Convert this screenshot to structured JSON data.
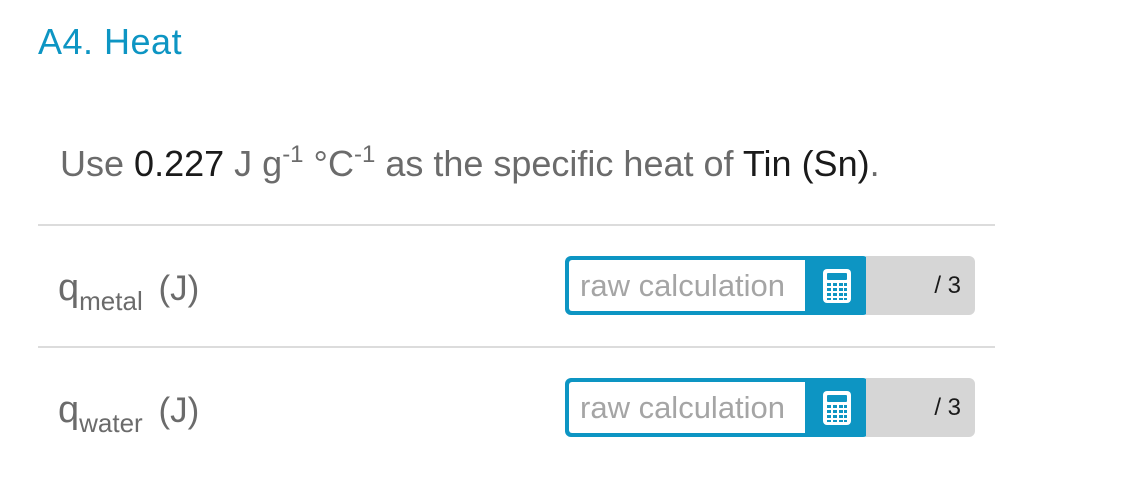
{
  "section": {
    "title": "A4. Heat"
  },
  "instruction": {
    "prefix": "Use",
    "value": "0.227",
    "unit_j": "J g",
    "exp1": "-1",
    "unit_c": "°C",
    "exp2": "-1",
    "middle": "as the specific heat of",
    "substance": "Tin (Sn)",
    "suffix": "."
  },
  "rows": [
    {
      "symbol": "q",
      "subscript": "metal",
      "unit": "(J)",
      "input_value": "",
      "placeholder": "raw calculation",
      "points": "/ 3"
    },
    {
      "symbol": "q",
      "subscript": "water",
      "unit": "(J)",
      "input_value": "",
      "placeholder": "raw calculation",
      "points": "/ 3"
    }
  ],
  "colors": {
    "accent": "#0d95c3",
    "muted_text": "#6b6b6b",
    "strong_text": "#1a1a1a",
    "points_bg": "#d6d6d6"
  },
  "icons": {
    "calculator": "calculator-icon"
  }
}
